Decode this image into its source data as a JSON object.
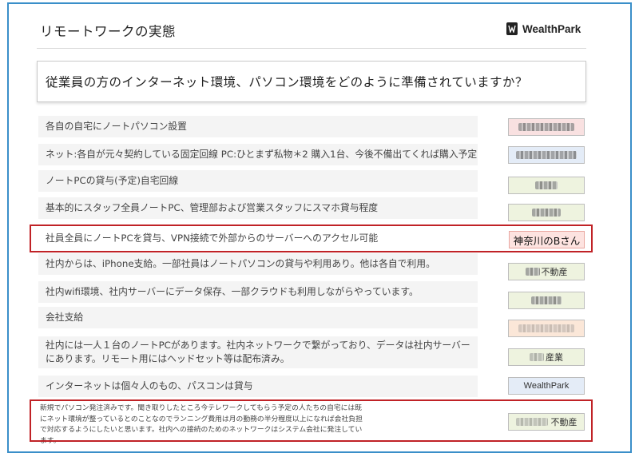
{
  "header": {
    "title": "リモートワークの実態",
    "logo_text": "WealthPark"
  },
  "question": "従業員の方のインターネット環境、パソコン環境をどのように準備されていますか？",
  "rows": [
    {
      "text": "各自の自宅にノートパソコン設置",
      "tag_fill": "#f9e1e1",
      "tag_label": ""
    },
    {
      "text": "ネット:各自が元々契約している固定回線 PC:ひとまず私物＊2 購入1台、今後不備出てくれば購入予定",
      "tag_fill": "#e4ecf7",
      "tag_label": ""
    },
    {
      "text": "ノートPCの貸与(予定)自宅回線",
      "tag_fill": "#eef3df",
      "tag_label": ""
    },
    {
      "text": "基本的にスタッフ全員ノートPC、管理部および営業スタッフにスマホ貸与程度",
      "tag_fill": "#eef3df",
      "tag_label": ""
    },
    {
      "text": "社員全員にノートPCを貸与、VPN接続で外部からのサーバーへのアクセル可能",
      "tag_fill": "#fde3e0",
      "tag_label": ""
    },
    {
      "text": "社内からは、iPhone支給。一部社員はノートパソコンの貸与や利用あり。他は各自で利用。",
      "tag_fill": "#eef3df",
      "tag_label": "不動産"
    },
    {
      "text": "社内wifi環境、社内サーバーにデータ保存、一部クラウドも利用しながらやっています。",
      "tag_fill": "#eef3df",
      "tag_label": ""
    },
    {
      "text": "会社支給",
      "tag_fill": "#fbe7d8",
      "tag_label": ""
    },
    {
      "text": "社内には一人１台のノートPCがあります。社内ネットワークで繋がっており、データは社内サーバーにあります。リモート用にはヘッドセット等は配布済み。",
      "tag_fill": "#eef3df",
      "tag_label": "産業"
    },
    {
      "text": "インターネットは個々人のもの、パスコンは貸与",
      "tag_fill": "#e4ecf7",
      "tag_label": "WealthPark"
    }
  ],
  "callout": "神奈川のBさん",
  "note": {
    "text": "新規でパソコン発注済みです。聞き取りしたところ今テレワークしてもらう予定の人たちの自宅には既にネット環境が整っているとのことなのでランニング費用は月の勤務の半分程度以上になれば会社負担で対応するようにしたいと思います。社内への接続のためのネットワークはシステム会社に発注しています。",
    "tag_label": "不動産"
  }
}
